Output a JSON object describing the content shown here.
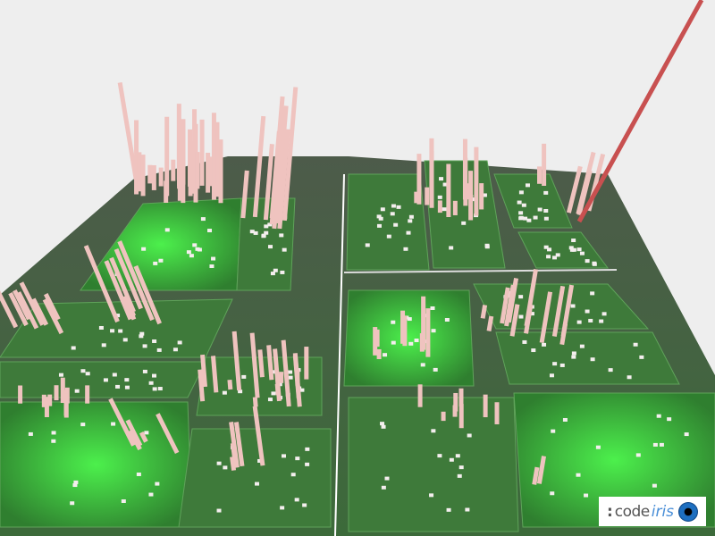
{
  "logo": {
    "prefix": ":",
    "word1": "code",
    "word2": "iris"
  },
  "colors": {
    "background": "#eeeeee",
    "ground": "#4a5a48",
    "tile": "#3f8a3a",
    "tile_bright": "#44e844",
    "bar": "#f0c4c0",
    "highlight_bar": "#c85050"
  }
}
